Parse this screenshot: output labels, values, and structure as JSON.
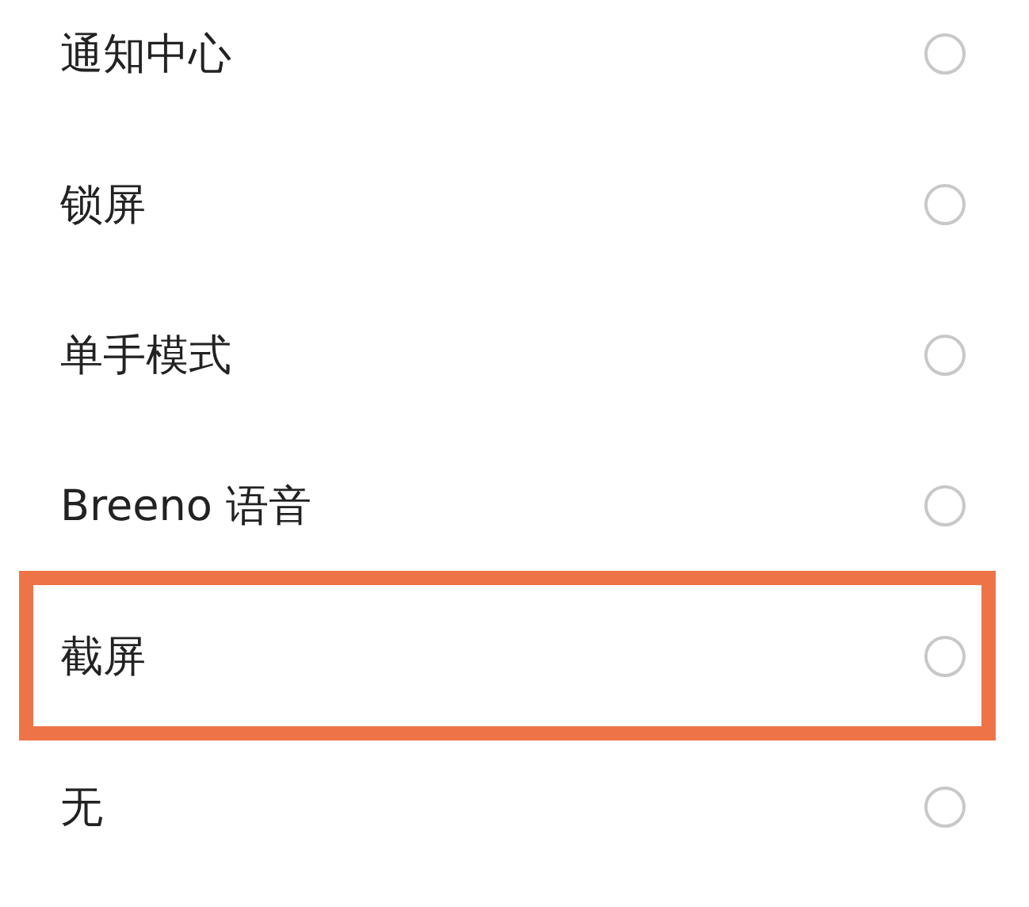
{
  "options": [
    {
      "label": "通知中心",
      "selected": false,
      "highlighted": false
    },
    {
      "label": "锁屏",
      "selected": false,
      "highlighted": false
    },
    {
      "label": "单手模式",
      "selected": false,
      "highlighted": false
    },
    {
      "label": "Breeno 语音",
      "selected": false,
      "highlighted": false
    },
    {
      "label": "截屏",
      "selected": false,
      "highlighted": true
    },
    {
      "label": "无",
      "selected": false,
      "highlighted": false
    }
  ]
}
